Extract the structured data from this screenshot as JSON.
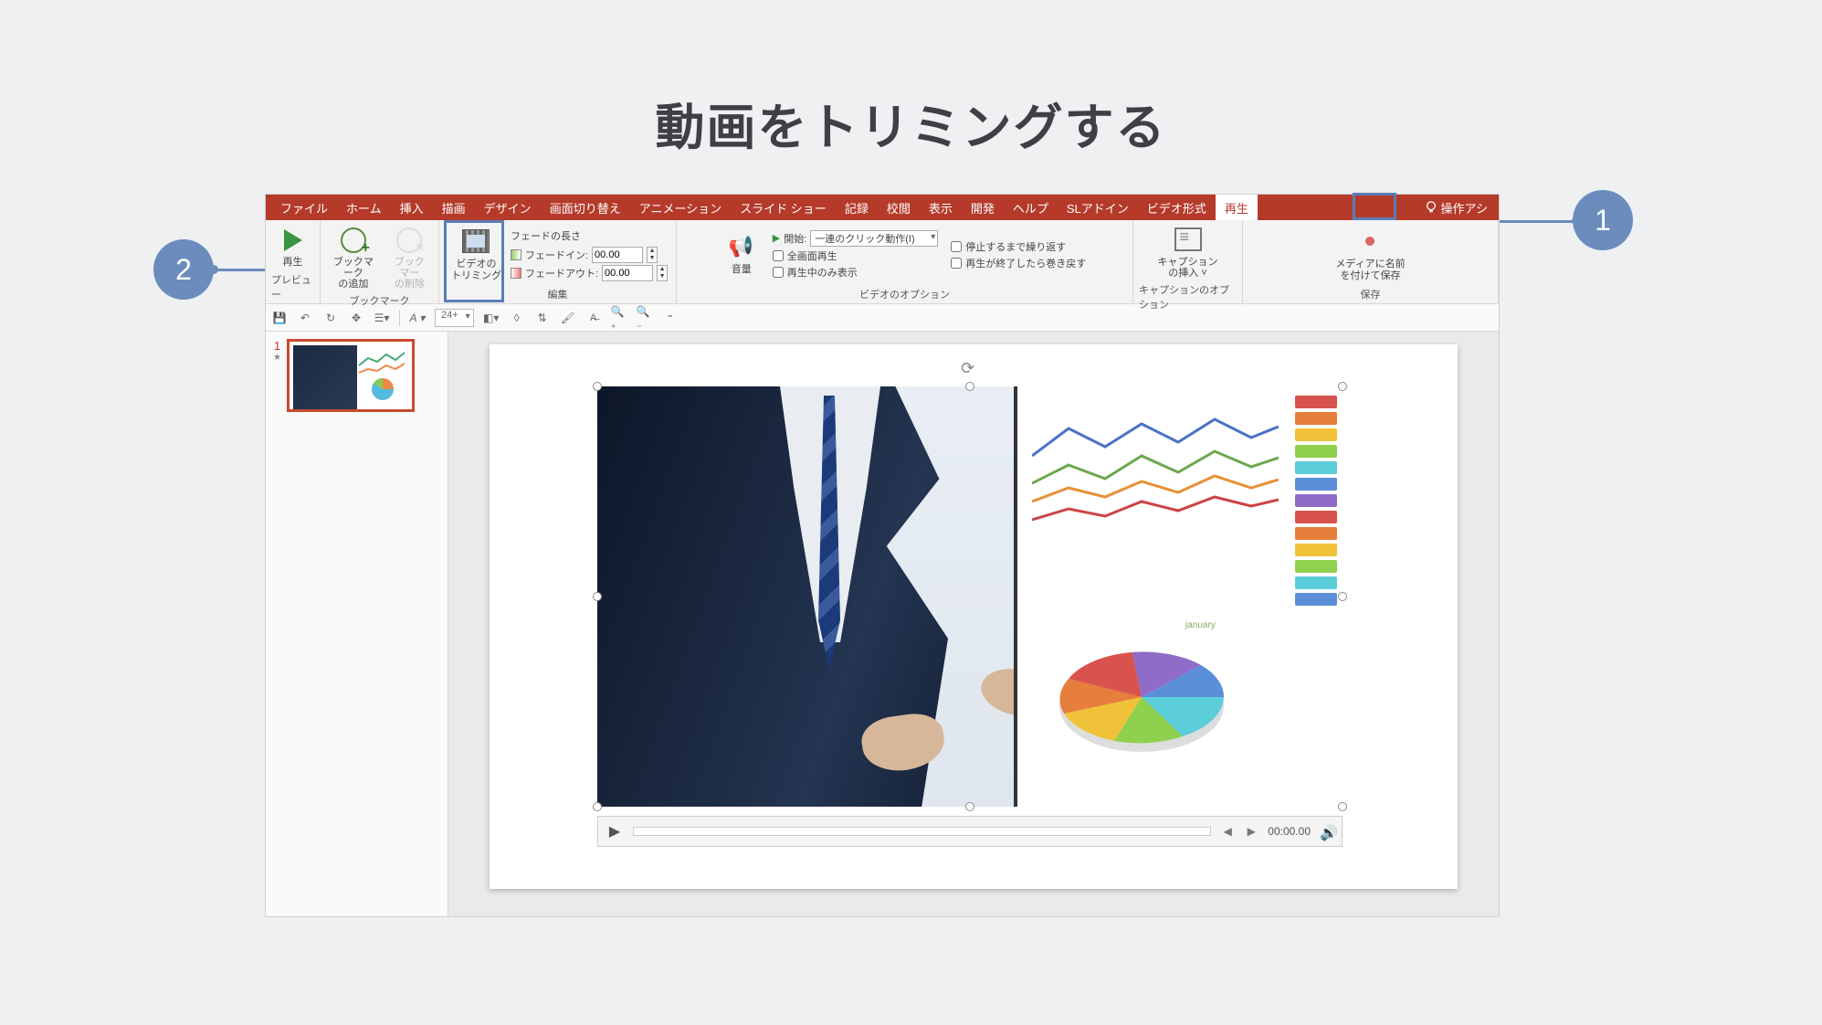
{
  "page_title": "動画をトリミングする",
  "callouts": {
    "one": "1",
    "two": "2"
  },
  "ribbon_tabs": {
    "file": "ファイル",
    "home": "ホーム",
    "insert": "挿入",
    "draw": "描画",
    "design": "デザイン",
    "transitions": "画面切り替え",
    "animations": "アニメーション",
    "slideshow": "スライド ショー",
    "record": "記録",
    "review": "校閲",
    "view": "表示",
    "developer": "開発",
    "help": "ヘルプ",
    "sladdin": "SLアドイン",
    "video_format": "ビデオ形式",
    "playback": "再生",
    "tell_me": "操作アシ"
  },
  "ribbon": {
    "preview": {
      "play": "再生",
      "group": "プレビュー"
    },
    "bookmark": {
      "add": "ブックマーク\nの追加",
      "remove": "ブックマー\nの削除",
      "group": "ブックマーク"
    },
    "trim": {
      "label": "ビデオの\nトリミング"
    },
    "fade": {
      "title": "フェードの長さ",
      "in_label": "フェードイン:",
      "out_label": "フェードアウト:",
      "in_val": "00.00",
      "out_val": "00.00"
    },
    "edit_group": "編集",
    "volume": "音量",
    "options": {
      "start_label": "開始:",
      "start_value": "一連のクリック動作(I)",
      "fullscreen": "全画面再生",
      "hide": "再生中のみ表示",
      "loop": "停止するまで繰り返す",
      "rewind": "再生が終了したら巻き戻す",
      "group": "ビデオのオプション"
    },
    "caption": {
      "label": "キャプション\nの挿入 ˅",
      "group": "キャプションのオプション"
    },
    "save": {
      "label": "メディアに名前\nを付けて保存",
      "group": "保存"
    }
  },
  "qat": {
    "fontsize": "24+"
  },
  "thumb": {
    "num": "1",
    "star": "★"
  },
  "playbar": {
    "time": "00:00.00"
  },
  "pie_label": "january",
  "colors": {
    "accent": "#b53a2a",
    "callout": "#6b8cbd",
    "highlight": "#5a7db8"
  }
}
